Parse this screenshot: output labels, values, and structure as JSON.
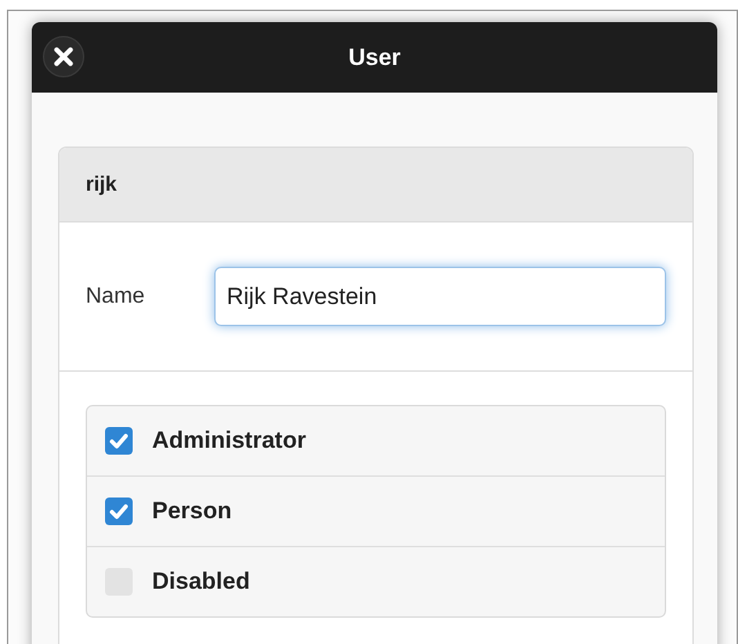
{
  "dialog": {
    "title": "User"
  },
  "card": {
    "heading": "rijk"
  },
  "name_field": {
    "label": "Name",
    "value": "Rijk Ravestein"
  },
  "checkboxes": [
    {
      "label": "Administrator",
      "checked": true
    },
    {
      "label": "Person",
      "checked": true
    },
    {
      "label": "Disabled",
      "checked": false
    }
  ]
}
